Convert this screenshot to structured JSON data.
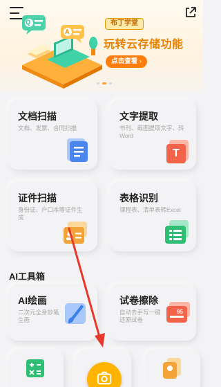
{
  "header": {
    "menu_icon": "hamburger-menu-icon",
    "share_icon": "share-export-icon"
  },
  "banner": {
    "badge": "布丁学堂",
    "title": "玩转云存储功能",
    "cta": "点击查看",
    "illustration_letters": [
      "Q",
      "A"
    ],
    "accent_color": "#ff7d0d",
    "title_color": "#e88200"
  },
  "tools": [
    {
      "title": "文档扫描",
      "subtitle": "文档、发票、合同扫描",
      "icon": "document-scan-icon",
      "color": "#4a86f0"
    },
    {
      "title": "文字提取",
      "subtitle": "书刊、截图提取文字、转Word",
      "icon": "text-extract-icon",
      "icon_letter": "T",
      "color": "#f2634a"
    },
    {
      "title": "证件扫描",
      "subtitle": "身份证、户口本等证件生成",
      "icon": "id-card-scan-icon",
      "color": "#f2a43a"
    },
    {
      "title": "表格识别",
      "subtitle": "课程表、清单表转Excel",
      "icon": "table-recognize-icon",
      "color": "#2fbf74"
    }
  ],
  "ai_section": {
    "label": "AI工具箱",
    "items": [
      {
        "title": "AI绘画",
        "subtitle": "二次元全身妙笔生画",
        "icon": "ai-brush-icon",
        "color": "#3b82e8"
      },
      {
        "title": "试卷擦除",
        "subtitle": "自动去手写一键还原试卷",
        "icon": "exam-erase-icon",
        "icon_text": "95",
        "color": "#f2634a"
      }
    ]
  },
  "bottom_row": [
    {
      "icon": "calculator-icon",
      "color": "#2fbf74"
    },
    {
      "icon": "placeholder-tool-icon",
      "color": "#dddddd"
    },
    {
      "icon": "certificate-icon",
      "color": "#f2a43a"
    }
  ],
  "fab": {
    "icon": "camera-icon",
    "color": "#ffb400"
  },
  "annotation": {
    "arrow_color": "#e8372b"
  }
}
